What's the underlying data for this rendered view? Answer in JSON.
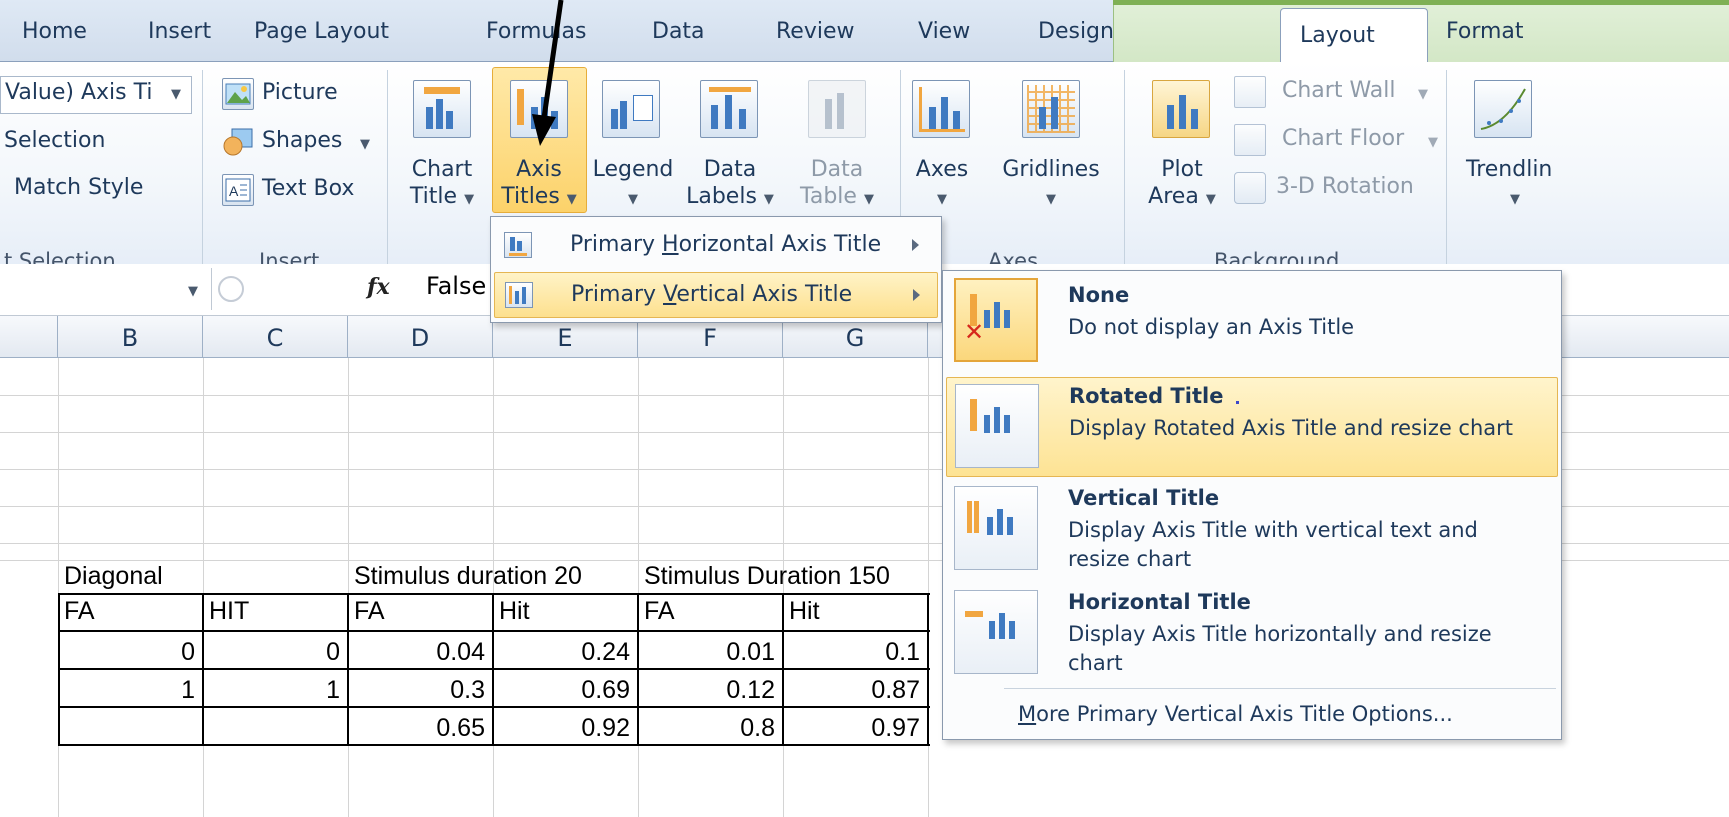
{
  "tabs": {
    "home": "Home",
    "insert": "Insert",
    "page_layout": "Page Layout",
    "formulas": "Formulas",
    "data": "Data",
    "review": "Review",
    "view": "View",
    "design": "Design",
    "layout": "Layout",
    "format": "Format"
  },
  "ribbon": {
    "current_selection": {
      "dropdown_value": "Value) Axis Ti",
      "format_selection": "Selection",
      "reset_match_style": "Match Style",
      "group_label": "t Selection"
    },
    "insert": {
      "picture": "Picture",
      "shapes": "Shapes",
      "text_box": "Text Box",
      "group_label": "Insert"
    },
    "labels": {
      "chart_title": [
        "Chart",
        "Title"
      ],
      "axis_titles": [
        "Axis",
        "Titles"
      ],
      "legend": [
        "Legend"
      ],
      "data_labels": [
        "Data",
        "Labels"
      ],
      "data_table": [
        "Data",
        "Table"
      ]
    },
    "axes": {
      "axes": [
        "Axes"
      ],
      "gridlines": [
        "Gridlines"
      ],
      "group_label": "Axes"
    },
    "background": {
      "plot_area": [
        "Plot",
        "Area"
      ],
      "chart_wall": "Chart Wall",
      "chart_floor": "Chart Floor",
      "rotation": "3-D Rotation",
      "group_label": "Background"
    },
    "analysis": {
      "trendline": "Trendlin"
    }
  },
  "formula_bar": {
    "fx": "fx",
    "value": "False"
  },
  "columns": [
    "B",
    "C",
    "D",
    "E",
    "F",
    "G"
  ],
  "sheet": {
    "header_row": [
      "Diagonal",
      "",
      "Stimulus duration 20",
      "",
      "Stimulus Duration 150",
      ""
    ],
    "label_row": [
      "FA",
      "HIT",
      "FA",
      "Hit",
      "FA",
      "Hit"
    ],
    "rows": [
      [
        "0",
        "0",
        "0.04",
        "0.24",
        "0.01",
        "0.1"
      ],
      [
        "1",
        "1",
        "0.3",
        "0.69",
        "0.12",
        "0.87"
      ],
      [
        "",
        "",
        "0.65",
        "0.92",
        "0.8",
        "0.97"
      ]
    ]
  },
  "axis_menu": {
    "horizontal": {
      "before": "Primary ",
      "accel": "H",
      "after": "orizontal Axis Title"
    },
    "vertical": {
      "before": "Primary ",
      "accel": "V",
      "after": "ertical Axis Title"
    }
  },
  "submenu": {
    "items": [
      {
        "title": "None",
        "desc": "Do not display an Axis Title"
      },
      {
        "title": "Rotated Title",
        "desc": "Display Rotated Axis Title and resize chart"
      },
      {
        "title": "Vertical Title",
        "desc": "Display Axis Title with vertical text and resize chart"
      },
      {
        "title": "Horizontal Title",
        "desc": "Display Axis Title horizontally and resize chart"
      }
    ],
    "more": {
      "accel": "M",
      "rest": "ore Primary Vertical Axis Title Options..."
    }
  },
  "colors": {
    "ribbon_text": "#1e395b",
    "highlight": "#fcd26a",
    "context_tab": "#7fb055",
    "arrow": "#000000"
  }
}
